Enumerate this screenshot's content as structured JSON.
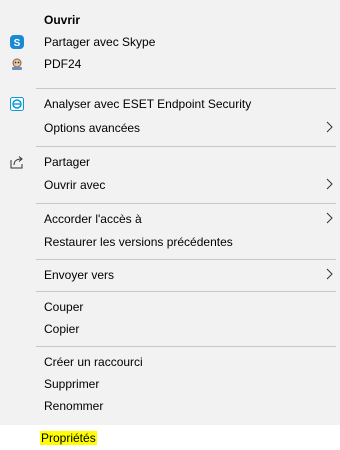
{
  "menu": {
    "items": [
      {
        "label": "Ouvrir"
      },
      {
        "label": "Partager avec Skype"
      },
      {
        "label": "PDF24"
      },
      {
        "label": "Analyser avec ESET Endpoint Security"
      },
      {
        "label": "Options avancées"
      },
      {
        "label": "Partager"
      },
      {
        "label": "Ouvrir avec"
      },
      {
        "label": "Accorder l'accès à"
      },
      {
        "label": "Restaurer les versions précédentes"
      },
      {
        "label": "Envoyer vers"
      },
      {
        "label": "Couper"
      },
      {
        "label": "Copier"
      },
      {
        "label": "Créer un raccourci"
      },
      {
        "label": "Supprimer"
      },
      {
        "label": "Renommer"
      },
      {
        "label": "Propriétés"
      }
    ]
  },
  "icons": {
    "skype": "skype-icon",
    "pdf24": "pdf24-icon",
    "eset": "eset-icon",
    "share": "share-icon",
    "submenu": "chevron-right-icon"
  },
  "colors": {
    "menu_background": "#f2f2f2",
    "separator": "#c8c8c8",
    "highlight": "#ffff00",
    "skype_blue": "#1a8ad4",
    "eset_teal": "#0a9bd6"
  }
}
